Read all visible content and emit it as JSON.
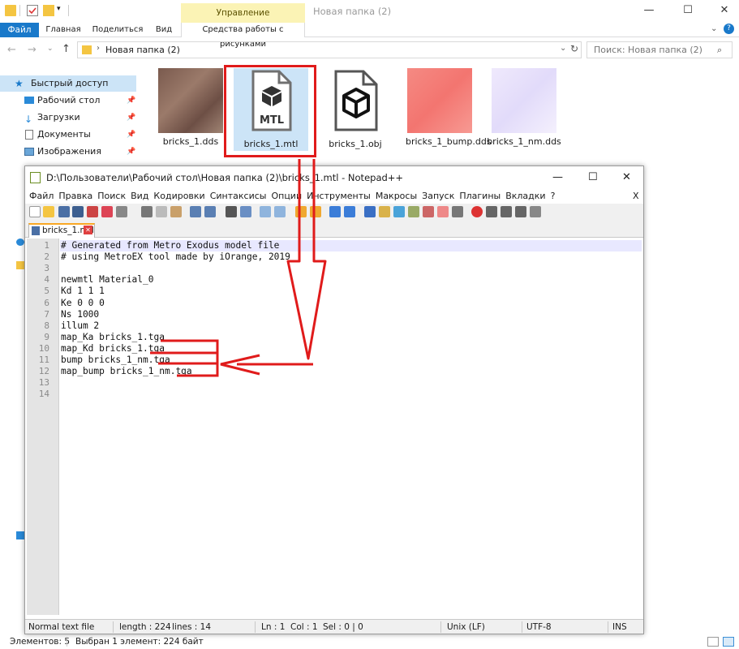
{
  "explorer": {
    "window_title": "Новая папка (2)",
    "ribbon": {
      "file_tab": "Файл",
      "tabs": [
        "Главная",
        "Поделиться",
        "Вид"
      ],
      "manage_header": "Управление",
      "manage_tab": "Средства работы с рисунками"
    },
    "address": {
      "path": "Новая папка (2)"
    },
    "search": {
      "placeholder": "Поиск: Новая папка (2)"
    },
    "nav": {
      "quick_access": "Быстрый доступ",
      "items": [
        "Рабочий стол",
        "Загрузки",
        "Документы",
        "Изображения"
      ]
    },
    "files": [
      {
        "name": "bricks_1.dds",
        "thumb": "#8e6a5c"
      },
      {
        "name": "bricks_1.mtl",
        "icon_text": "MTL"
      },
      {
        "name": "bricks_1.obj"
      },
      {
        "name": "bricks_1_bump.dds",
        "thumb": "#f4837c"
      },
      {
        "name": "bricks_1_nm.dds",
        "thumb": "#ece6fb"
      }
    ],
    "status": {
      "items_count": "Элементов: 5",
      "selected": "Выбран 1 элемент: 224 байт"
    }
  },
  "npp": {
    "title": "D:\\Пользователи\\Рабочий стол\\Новая папка (2)\\bricks_1.mtl - Notepad++",
    "menu": [
      "Файл",
      "Правка",
      "Поиск",
      "Вид",
      "Кодировки",
      "Синтаксисы",
      "Опции",
      "Инструменты",
      "Макросы",
      "Запуск",
      "Плагины",
      "Вкладки",
      "?"
    ],
    "menu_close": "X",
    "tab_name": "bricks_1.mtl",
    "lines": [
      "# Generated from Metro Exodus model file",
      "# using MetroEX tool made by iOrange, 2019",
      "",
      "newmtl Material_0",
      "Kd 1 1 1",
      "Ke 0 0 0",
      "Ns 1000",
      "illum 2",
      "map_Ka bricks_1.tga",
      "map_Kd bricks_1.tga",
      "bump bricks_1_nm.tga",
      "map_bump bricks_1_nm.tga",
      "",
      ""
    ],
    "line_numbers": [
      "1",
      "2",
      "3",
      "4",
      "5",
      "6",
      "7",
      "8",
      "9",
      "10",
      "11",
      "12",
      "13",
      "14"
    ],
    "status": {
      "filetype": "Normal text file",
      "length": "length : 224",
      "lines": "lines : 14",
      "ln": "Ln : 1",
      "col": "Col : 1",
      "sel": "Sel : 0 | 0",
      "eol": "Unix (LF)",
      "encoding": "UTF-8",
      "mode": "INS"
    }
  },
  "colors": {
    "annotation": "#e01b1b",
    "file_tab": "#1979ca",
    "selection": "#cce4f7"
  }
}
